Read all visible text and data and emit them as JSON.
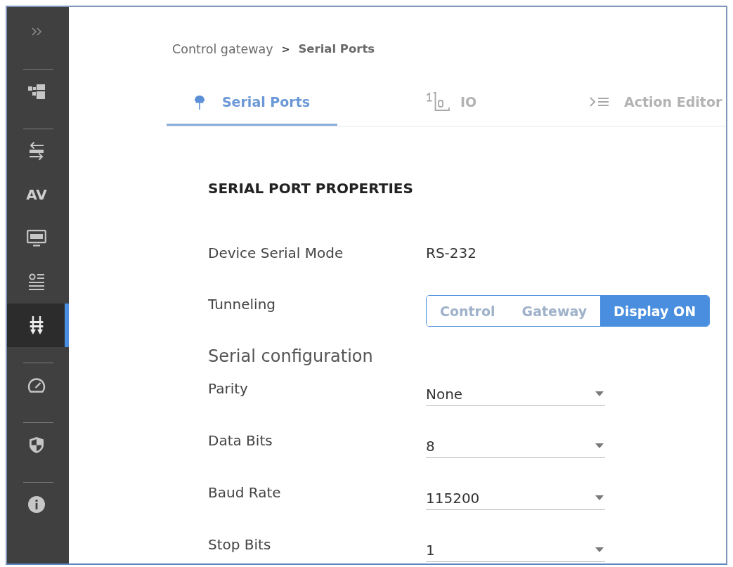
{
  "sidebar": {
    "groups": [
      {
        "items": [
          {
            "kind": "icon",
            "selected": false
          }
        ]
      },
      {
        "items": [
          {
            "kind": "icon",
            "selected": false
          }
        ]
      },
      {
        "items": [
          {
            "kind": "icon",
            "selected": false
          },
          {
            "kind": "text",
            "label": "AV",
            "selected": false
          },
          {
            "kind": "icon",
            "selected": false
          },
          {
            "kind": "icon",
            "selected": false
          },
          {
            "kind": "icon",
            "selected": true
          }
        ]
      },
      {
        "items": [
          {
            "kind": "icon",
            "selected": false
          }
        ]
      },
      {
        "items": [
          {
            "kind": "icon",
            "selected": false
          }
        ]
      },
      {
        "items": [
          {
            "kind": "icon",
            "selected": false
          }
        ]
      }
    ]
  },
  "breadcrumb": {
    "separator": ">",
    "items": [
      {
        "label": "Control gateway",
        "current": false
      },
      {
        "label": "Serial Ports",
        "current": true
      }
    ]
  },
  "tabs": [
    {
      "label": "Serial Ports",
      "selected": true
    },
    {
      "label": "IO",
      "selected": false
    },
    {
      "label": "Action Editor",
      "selected": false
    }
  ],
  "panel": {
    "title": "SERIAL PORT PROPERTIES",
    "properties": [
      {
        "kind": "text",
        "label": "Device Serial Mode",
        "value": "RS-232"
      },
      {
        "kind": "segmented",
        "label": "Tunneling",
        "options": [
          {
            "label": "Control",
            "selected": false,
            "disabled": true
          },
          {
            "label": "Gateway",
            "selected": false,
            "disabled": true
          },
          {
            "label": "Display ON",
            "selected": true,
            "disabled": false
          }
        ]
      }
    ],
    "config": {
      "title": "Serial configuration",
      "fields": [
        {
          "label": "Parity",
          "value": "None"
        },
        {
          "label": "Data Bits",
          "value": "8"
        },
        {
          "label": "Baud Rate",
          "value": "115200"
        },
        {
          "label": "Stop Bits",
          "value": "1"
        }
      ]
    }
  }
}
